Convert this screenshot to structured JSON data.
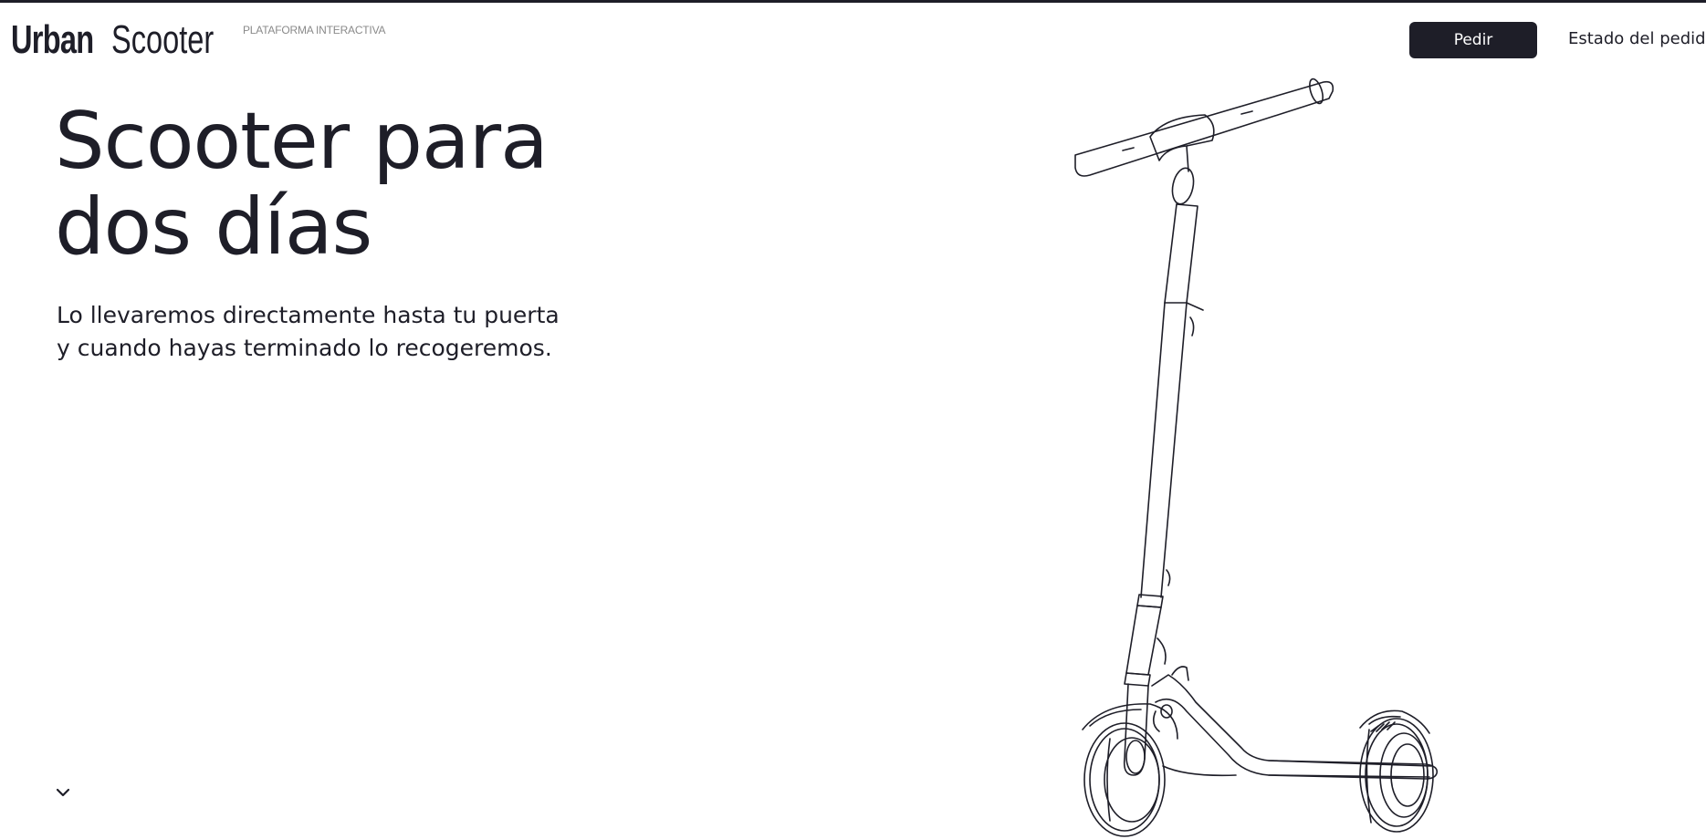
{
  "brand": {
    "name_bold": "Urban",
    "name_light": "Scooter",
    "tagline": "PLATAFORMA INTERACTIVA"
  },
  "nav": {
    "order_button": "Pedir",
    "status_link": "Estado del pedido"
  },
  "hero": {
    "title_line1": "Scooter para",
    "title_line2": "dos días",
    "subtitle_line1": "Lo llevaremos directamente hasta tu puerta",
    "subtitle_line2": "y cuando hayas terminado lo recogeremos."
  },
  "icons": {
    "scroll": "chevron-down-icon",
    "illustration": "scooter-illustration"
  },
  "colors": {
    "primary_dark": "#1e1e28",
    "background": "#ffffff",
    "tagline_gray": "#8a8a8a"
  }
}
